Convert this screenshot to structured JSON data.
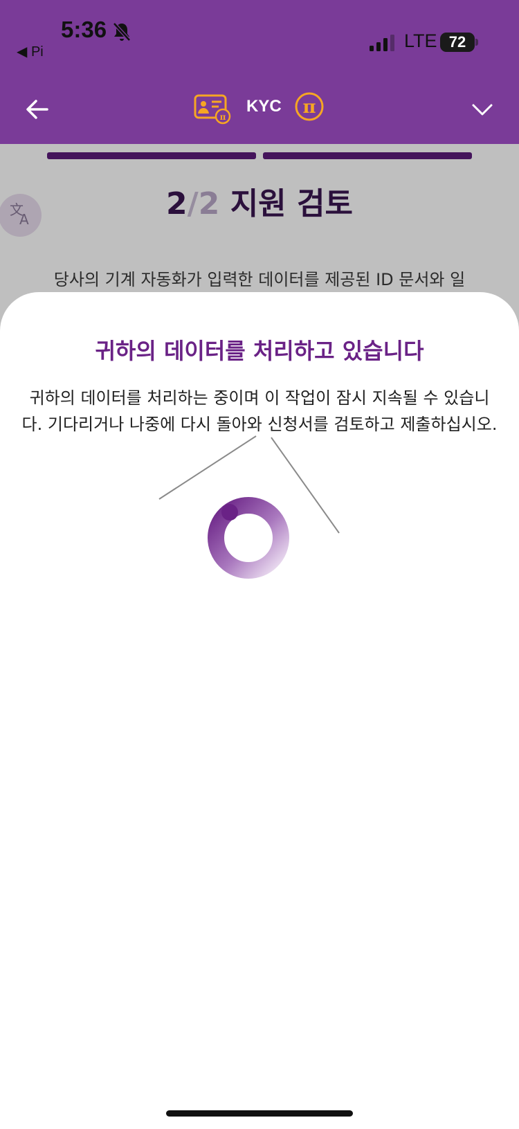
{
  "status_bar": {
    "time": "5:36",
    "back_app_label": "◀ Pi",
    "network": "LTE",
    "battery": "72"
  },
  "app_bar": {
    "title": "KYC",
    "icons": [
      "back-arrow-icon",
      "id-card-icon",
      "pi-coin-icon",
      "chevron-down-icon"
    ],
    "accent_color": "#7a3b98",
    "icon_color": "#f6a623"
  },
  "background_page": {
    "steps_completed": 2,
    "steps_total": 2,
    "step_current": "2",
    "step_separator": "/",
    "step_total_label": "2",
    "step_title": "지원 검토",
    "description": "당사의 기계 자동화가 입력한 데이터를 제공된 ID 문서와 일"
  },
  "sheet": {
    "title": "귀하의 데이터를 처리하고 있습니다",
    "body": "귀하의 데이터를 처리하는 중이며 이 작업이 잠시 지속될 수 있습니다. 기다리거나 나중에 다시 돌아와 신청서를 검토하고 제출하십시오.",
    "title_color": "#6a2286",
    "spinner_color": "#7a3b98"
  }
}
